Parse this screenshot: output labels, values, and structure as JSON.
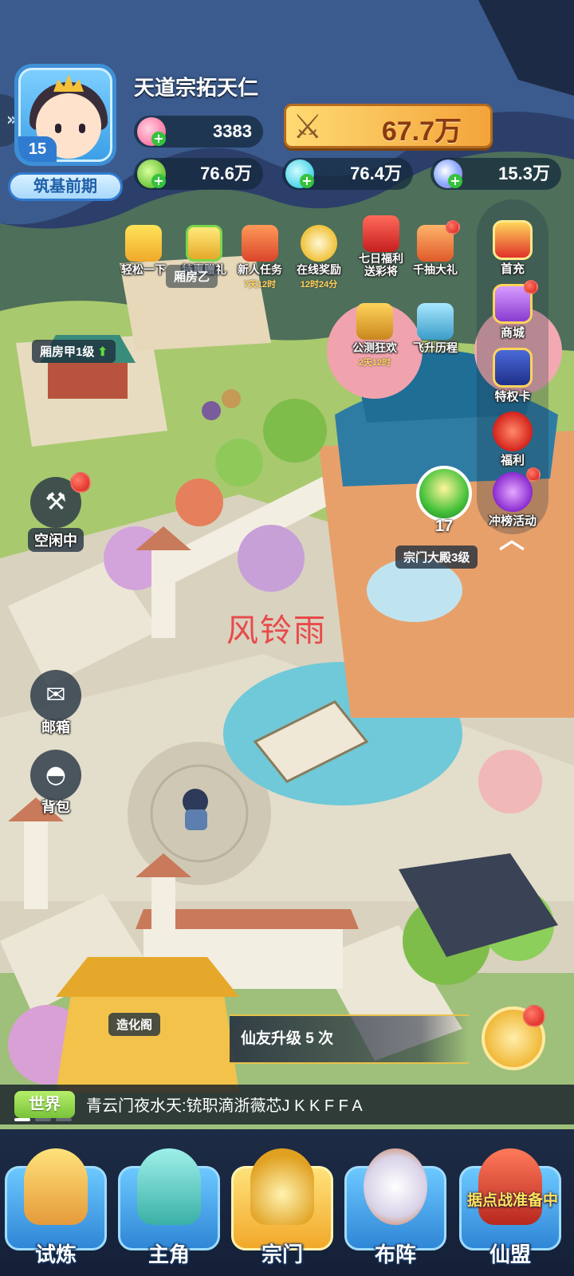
{
  "player": {
    "name": "天道宗拓天仁",
    "level": "15",
    "realm": "筑基前期",
    "resources": {
      "peach": "3383",
      "jade": "76.6万",
      "gem": "76.4万",
      "spirit": "15.3万"
    },
    "power": "67.7万"
  },
  "events": [
    {
      "label": "轻松一下",
      "sub": ""
    },
    {
      "label": "特惠赠礼",
      "sub": ""
    },
    {
      "label": "新人任务",
      "sub": "7天12时"
    },
    {
      "label": "在线奖励",
      "sub": "12时24分"
    },
    {
      "label": "七日福利\n送彩将",
      "sub": ""
    },
    {
      "label": "千抽大礼",
      "sub": ""
    },
    {
      "label": "公测狂欢",
      "sub": "2天12时"
    },
    {
      "label": "飞升历程",
      "sub": ""
    }
  ],
  "side_menu": {
    "items": [
      {
        "label": "首充"
      },
      {
        "label": "商城"
      },
      {
        "label": "特权卡"
      },
      {
        "label": "福利"
      },
      {
        "label": "冲榜活动"
      }
    ]
  },
  "map": {
    "building_yi": "厢房乙",
    "building_jia": "厢房甲1级",
    "hall": "宗门大殿3级",
    "hall_badge": "17",
    "forge": "造化阁",
    "watermark": "风铃雨"
  },
  "left_buttons": {
    "idle": "空闲中",
    "mail": "邮箱",
    "bag": "背包"
  },
  "quest": {
    "text": "仙友升级 5 次"
  },
  "chat": {
    "channel": "世界",
    "message": "青云门夜水天:铳职滴浙薇芯J K K F F A"
  },
  "nav": {
    "items": [
      {
        "label": "试炼"
      },
      {
        "label": "主角"
      },
      {
        "label": "宗门"
      },
      {
        "label": "布阵"
      },
      {
        "label": "仙盟"
      }
    ],
    "alliance_banner": "据点战准备中"
  },
  "colors": {
    "power_gold": "#f3a43a",
    "red_dot": "#d61b12",
    "active_tab": "#f2a82a",
    "nav_bg": "#1d2b45"
  }
}
